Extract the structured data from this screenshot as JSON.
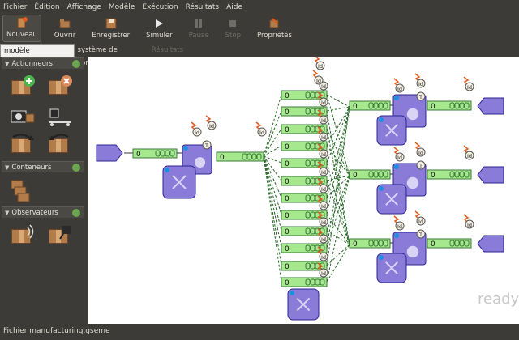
{
  "menu": [
    "Fichier",
    "Édition",
    "Affichage",
    "Modèle",
    "Exécution",
    "Résultats",
    "Aide"
  ],
  "toolbar": {
    "new_label": "Nouveau",
    "open_label": "Ouvrir",
    "save_label": "Enregistrer",
    "simulate_label": "Simuler",
    "pause_label": "Pause",
    "stop_label": "Stop",
    "properties_label": "Propriétés"
  },
  "tabs": {
    "emulation": "modèle d'émulation",
    "control": "système de contrôle",
    "results": "Résultats"
  },
  "palette": {
    "actuators": "Actionneurs",
    "containers": "Conteneurs",
    "observers": "Observateurs"
  },
  "canvas": {
    "status_text": "ready",
    "buffer_value": "0",
    "sensor_label": "Id",
    "timer_label": "T"
  },
  "statusbar": {
    "file": "Fichier manufacturing.gseme"
  },
  "colors": {
    "buffer": "#a6e88e",
    "node": "#8a7bd8",
    "link": "#2a6a2a",
    "accent": "#e25a1c"
  }
}
